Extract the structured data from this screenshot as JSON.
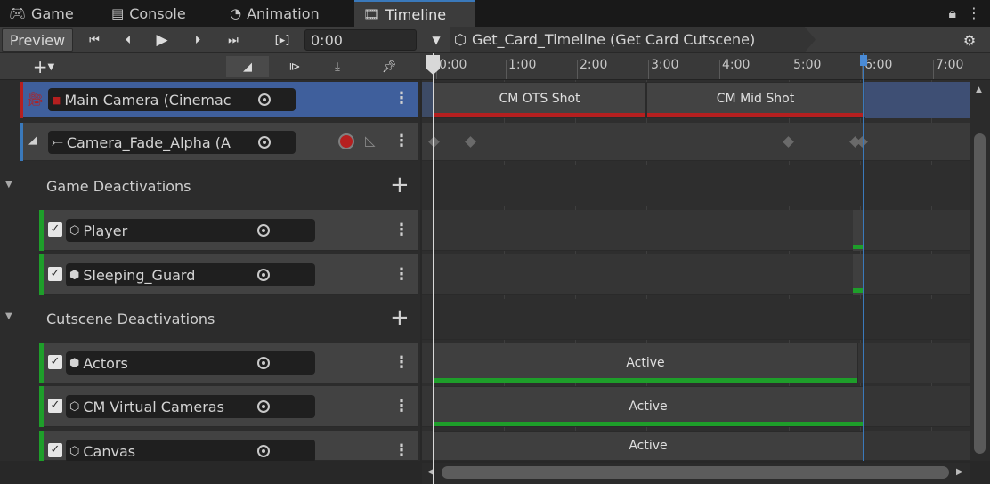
{
  "tabs": [
    {
      "label": "Game",
      "icon": "gamepad-icon"
    },
    {
      "label": "Console",
      "icon": "console-icon"
    },
    {
      "label": "Animation",
      "icon": "clock-icon"
    },
    {
      "label": "Timeline",
      "icon": "film-icon",
      "active": true
    }
  ],
  "toolbar": {
    "preview_label": "Preview",
    "time_value": "0:00",
    "asset_name": "Get_Card_Timeline (Get Card Cutscene)"
  },
  "ruler": {
    "labels": [
      "0:00",
      "1:00",
      "2:00",
      "3:00",
      "4:00",
      "5:00",
      "6:00",
      "7:00"
    ]
  },
  "tracks": {
    "main_camera": {
      "name": "Main Camera (Cinemac"
    },
    "camera_fade": {
      "name": "Camera_Fade_Alpha (A"
    },
    "game_group": {
      "label": "Game Deactivations"
    },
    "player": {
      "name": "Player"
    },
    "sleeping_guard": {
      "name": "Sleeping_Guard"
    },
    "cutscene_group": {
      "label": "Cutscene Deactivations"
    },
    "actors": {
      "name": "Actors"
    },
    "cm_virtual_cameras": {
      "name": "CM Virtual Cameras"
    },
    "canvas": {
      "name": "Canvas"
    }
  },
  "clips": {
    "cm_ots": "CM OTS Shot",
    "cm_mid": "CM Mid Shot",
    "actors_active": "Active",
    "cm_active": "Active",
    "canvas_active": "Active"
  },
  "colors": {
    "accent_blue": "#3a79bb",
    "camera_track_red": "#b51f1f",
    "activation_green": "#1e9e2a",
    "selected_row_blue": "#3f5f9c"
  }
}
